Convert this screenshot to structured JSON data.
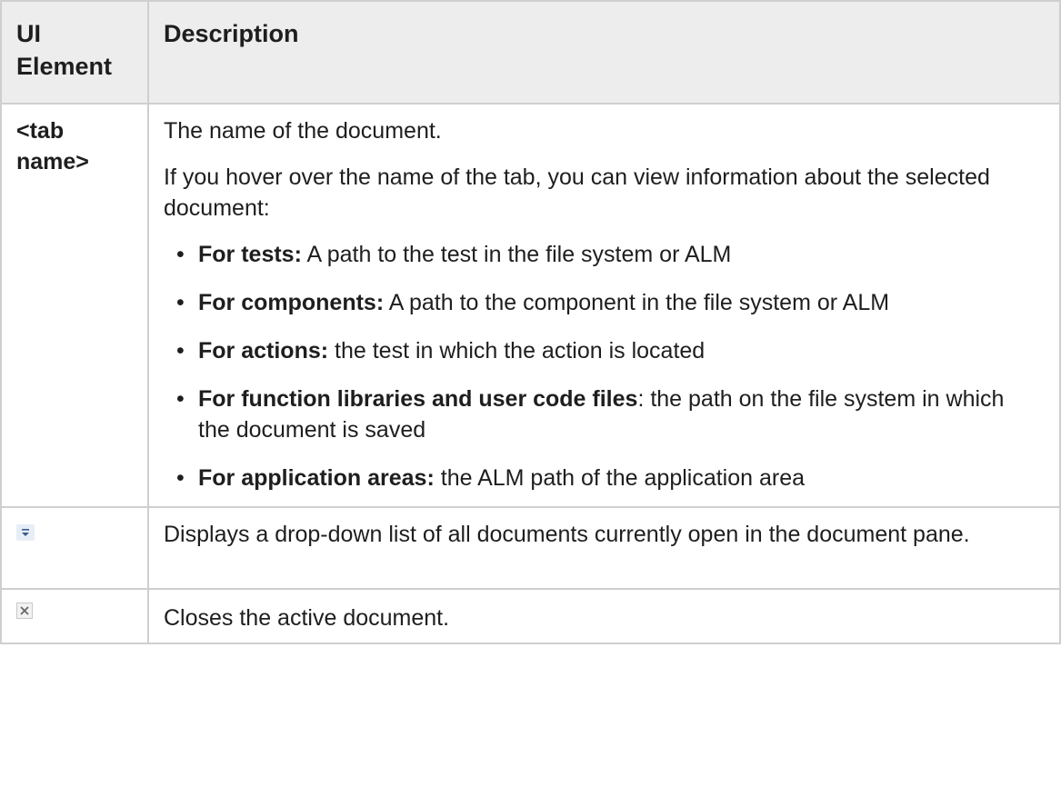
{
  "table": {
    "headers": {
      "element": "UI Element",
      "description": "Description"
    },
    "rows": {
      "tab_name": {
        "element": "<tab name>",
        "intro": "The name of the document.",
        "hover_text": "If you hover over the name of the tab, you can view information about the selected document:",
        "items": [
          {
            "label": "For tests:",
            "text": " A path to the test in the file system or ALM"
          },
          {
            "label": "For components:",
            "text": " A path to the component in the file system or ALM"
          },
          {
            "label": "For actions:",
            "text": " the test in which the action is located"
          },
          {
            "label": "For function libraries and user code files",
            "text": ": the path on the file system in which the document is saved"
          },
          {
            "label": "For application areas:",
            "text": " the ALM path of the application area"
          }
        ]
      },
      "dropdown": {
        "icon": "dropdown-list-icon",
        "description": "Displays a drop-down list of all documents currently open in the document pane."
      },
      "close": {
        "icon": "close-document-icon",
        "description": "Closes the active document."
      }
    }
  },
  "colors": {
    "header_bg": "#ededed",
    "border": "#cfcfcf",
    "dropdown_icon_bg": "#e8eef7",
    "dropdown_icon_fg": "#3a5a8c"
  }
}
